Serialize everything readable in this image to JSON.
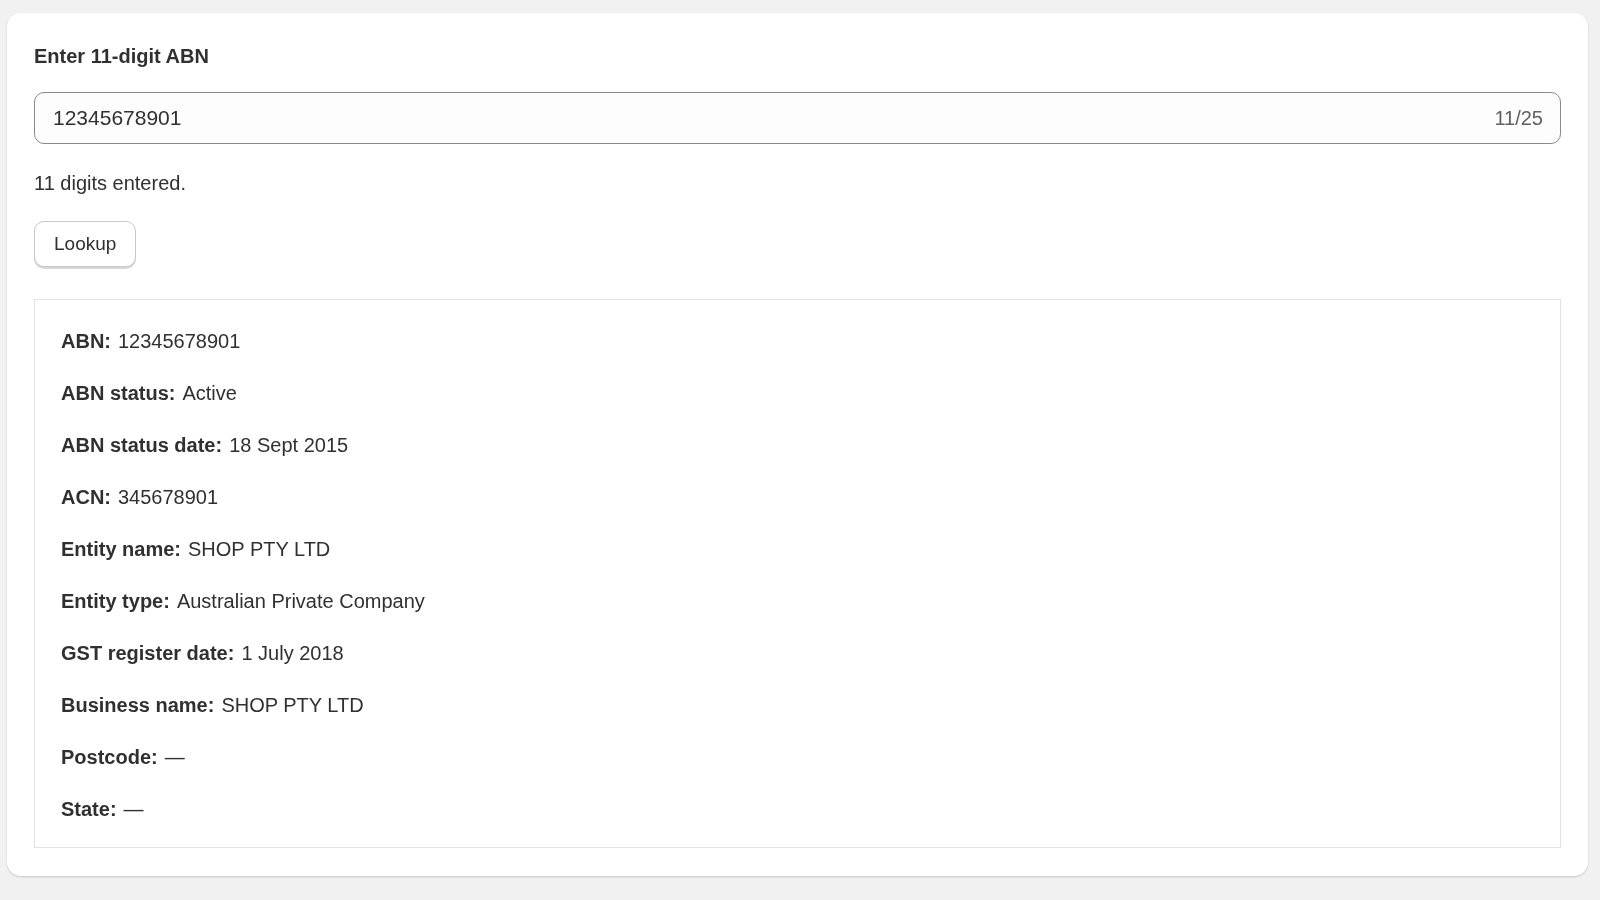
{
  "field": {
    "label": "Enter 11-digit ABN",
    "value": "12345678901",
    "counter": "11/25",
    "helper": "11 digits entered."
  },
  "button": "Lookup",
  "details": [
    {
      "label": "ABN:",
      "value": "12345678901"
    },
    {
      "label": "ABN status:",
      "value": "Active"
    },
    {
      "label": "ABN status date:",
      "value": "18 Sept 2015"
    },
    {
      "label": "ACN:",
      "value": "345678901"
    },
    {
      "label": "Entity name:",
      "value": "SHOP PTY LTD"
    },
    {
      "label": "Entity type:",
      "value": "Australian Private Company"
    },
    {
      "label": "GST register date:",
      "value": "1 July 2018"
    },
    {
      "label": "Business name:",
      "value": "SHOP PTY LTD"
    },
    {
      "label": "Postcode:",
      "value": "—"
    },
    {
      "label": "State:",
      "value": "—"
    }
  ]
}
